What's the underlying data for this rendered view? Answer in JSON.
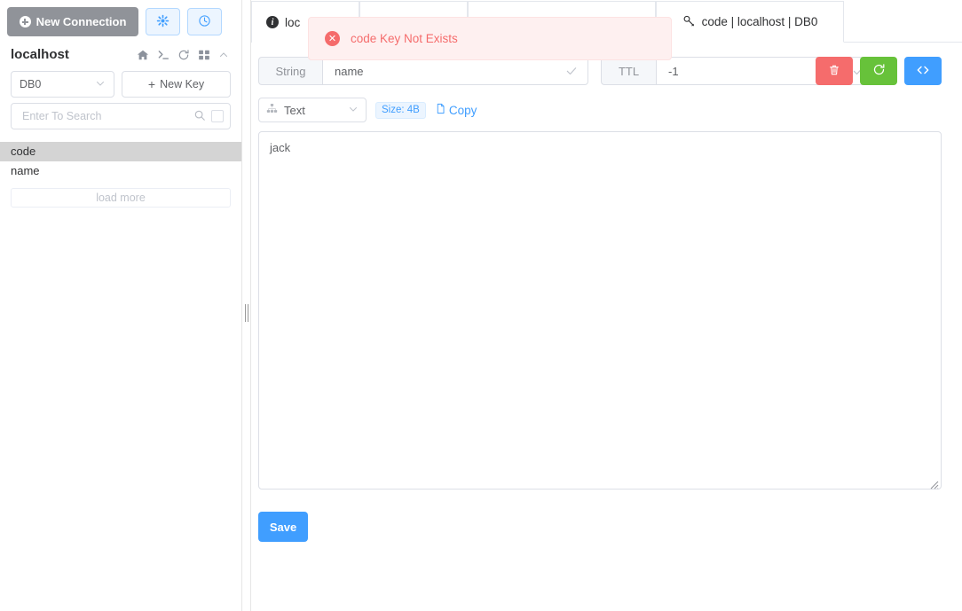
{
  "sidebar": {
    "new_connection_label": "New Connection",
    "settings_icon": "gear-icon",
    "history_icon": "clock-icon",
    "host_name": "localhost",
    "host_icons": [
      "home-icon",
      "terminal-icon",
      "refresh-icon",
      "grid-icon",
      "chevron-up-icon"
    ],
    "db_select_value": "DB0",
    "new_key_label": "New Key",
    "search_placeholder": "Enter To Search",
    "search_value": "",
    "keys": [
      {
        "label": "code",
        "selected": true
      },
      {
        "label": "name",
        "selected": false
      }
    ],
    "load_more_label": "load more"
  },
  "tabs": [
    {
      "label": "loc",
      "icon": "info-icon",
      "active": false
    },
    {
      "label": "",
      "icon": "",
      "active": false
    },
    {
      "label": "code | localhost | DB0",
      "icon": "key-icon",
      "active": true
    }
  ],
  "toast": {
    "message": "code Key Not Exists",
    "icon": "error-circle-icon",
    "bg_color": "#fef0f0",
    "border_color": "#fde2e2",
    "text_color": "#f56c6c"
  },
  "key_toolbar": {
    "type_label": "String",
    "key_name": "name",
    "key_confirm_icon": "check-icon",
    "ttl_label": "TTL",
    "ttl_value": "-1",
    "ttl_clear_icon": "close-icon",
    "ttl_confirm_icon": "check-icon",
    "actions": [
      {
        "name": "delete-key-button",
        "icon": "trash-icon",
        "color": "#f56c6c"
      },
      {
        "name": "refresh-key-button",
        "icon": "refresh-icon",
        "color": "#67c23a"
      },
      {
        "name": "code-view-button",
        "icon": "code-icon",
        "color": "#409eff"
      }
    ]
  },
  "value_panel": {
    "format_icon": "sitemap-icon",
    "format_value": "Text",
    "size_badge": "Size: 4B",
    "copy_label": "Copy",
    "copy_icon": "document-icon",
    "value_text": "jack",
    "save_label": "Save"
  }
}
